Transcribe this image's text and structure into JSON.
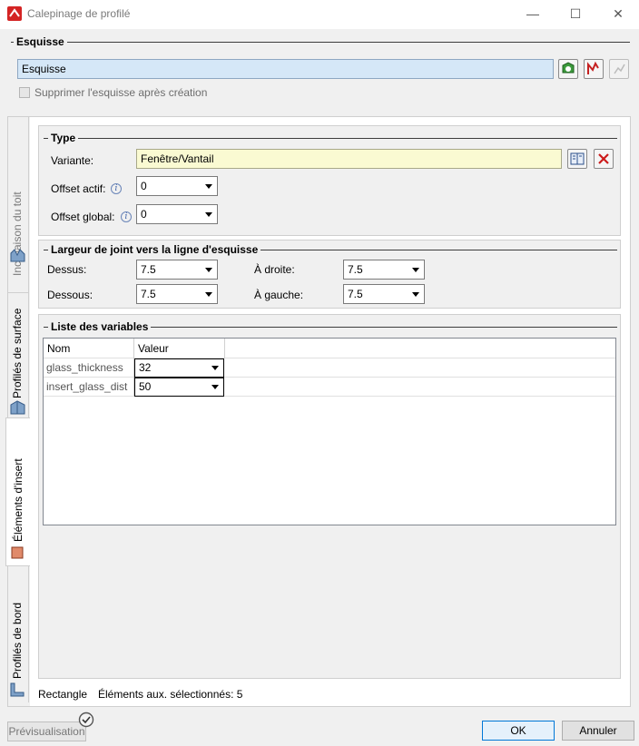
{
  "window": {
    "title": "Calepinage de profilé",
    "minimize": "—",
    "maximize": "☐",
    "close": "✕"
  },
  "sketch": {
    "group_title": "Esquisse",
    "field_value": "Esquisse",
    "delete_checkbox_label": "Supprimer l'esquisse après création",
    "delete_checked": false
  },
  "tabs": [
    {
      "label": "Inclinaison du toit",
      "active": false
    },
    {
      "label": "Profilés de surface",
      "active": false
    },
    {
      "label": "Éléments d'insert",
      "active": true
    },
    {
      "label": "Profilés de bord",
      "active": false
    }
  ],
  "type_group": {
    "title": "Type",
    "variant_label": "Variante:",
    "variant_value": "Fenêtre/Vantail",
    "offset_actif_label": "Offset actif:",
    "offset_actif_value": "0",
    "offset_global_label": "Offset global:",
    "offset_global_value": "0"
  },
  "joint_group": {
    "title": "Largeur de joint vers la ligne d'esquisse",
    "dessus_label": "Dessus:",
    "dessus_value": "7.5",
    "dessous_label": "Dessous:",
    "dessous_value": "7.5",
    "droite_label": "À droite:",
    "droite_value": "7.5",
    "gauche_label": "À gauche:",
    "gauche_value": "7.5"
  },
  "variables": {
    "title": "Liste des variables",
    "columns": [
      "Nom",
      "Valeur"
    ],
    "rows": [
      {
        "name": "glass_thickness",
        "value": "32"
      },
      {
        "name": "insert_glass_dist",
        "value": "50"
      }
    ]
  },
  "status": {
    "shape": "Rectangle",
    "selected": "Éléments aux. sélectionnés: 5"
  },
  "footer": {
    "preview_label": "Prévisualisation",
    "ok_label": "OK",
    "cancel_label": "Annuler"
  },
  "colors": {
    "sketch_field_bg": "#d5e7f7",
    "variant_field_bg": "#fafad2",
    "active_tab_bg": "#ffffff"
  }
}
